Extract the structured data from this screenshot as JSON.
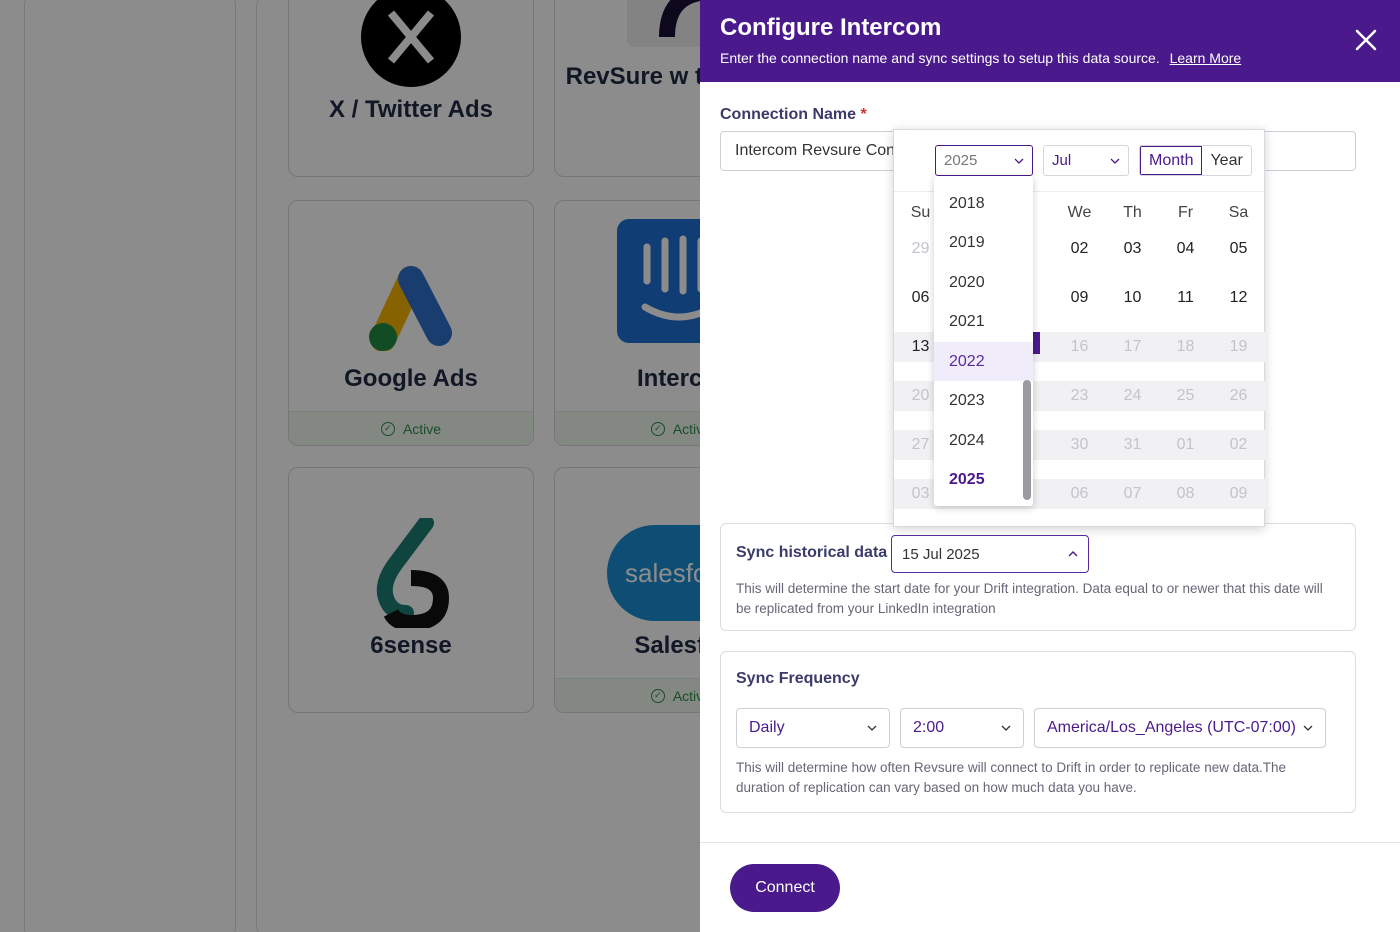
{
  "background": {
    "cards": [
      {
        "name": "X / Twitter Ads",
        "status": ""
      },
      {
        "name": "RevSure w tracking",
        "status": ""
      },
      {
        "name": "Google Ads",
        "status": "Active"
      },
      {
        "name": "Interco",
        "status": "Activ"
      },
      {
        "name": "6sense",
        "status": ""
      },
      {
        "name": "Salesfo",
        "status": "Activ"
      }
    ],
    "salesforce_logo_text": "salesfo"
  },
  "drawer": {
    "title": "Configure Intercom",
    "subtitle": "Enter the connection name and sync settings to setup this data source.",
    "learn_more": "Learn More",
    "connection_name_label": "Connection Name",
    "required_mark": "*",
    "connection_name_value": "Intercom Revsure Con",
    "sync_historical": {
      "label": "Sync historical data",
      "value": "15 Jul 2025",
      "description": "This will determine the start date for your Drift integration. Data equal to or newer that this date will be replicated from your LinkedIn integration"
    },
    "sync_frequency": {
      "label": "Sync Frequency",
      "interval": "Daily",
      "time": "2:00",
      "timezone": "America/Los_Angeles (UTC-07:00)",
      "description": "This will determine how often Revsure will connect to Drift in order to replicate new data.The duration of replication can vary based on how much data you have."
    },
    "connect_label": "Connect"
  },
  "calendar": {
    "year_value": "2025",
    "month_value": "Jul",
    "mode_month": "Month",
    "mode_year": "Year",
    "weekdays": [
      "Su",
      "",
      "",
      "We",
      "Th",
      "Fr",
      "Sa"
    ],
    "rows": [
      [
        "29",
        "",
        "",
        "02",
        "03",
        "04",
        "05"
      ],
      [
        "06",
        "",
        "",
        "09",
        "10",
        "11",
        "12"
      ],
      [
        "13",
        "",
        "",
        "16",
        "17",
        "18",
        "19"
      ],
      [
        "20",
        "",
        "",
        "23",
        "24",
        "25",
        "26"
      ],
      [
        "27",
        "",
        "",
        "30",
        "31",
        "01",
        "02"
      ],
      [
        "03",
        "",
        "",
        "06",
        "07",
        "08",
        "09"
      ]
    ],
    "year_options": [
      "2018",
      "2019",
      "2020",
      "2021",
      "2022",
      "2023",
      "2024",
      "2025"
    ],
    "hovered_year": "2022",
    "selected_year": "2025"
  },
  "colors": {
    "brand": "#4a1a8c",
    "active_green": "#2e8b47"
  }
}
